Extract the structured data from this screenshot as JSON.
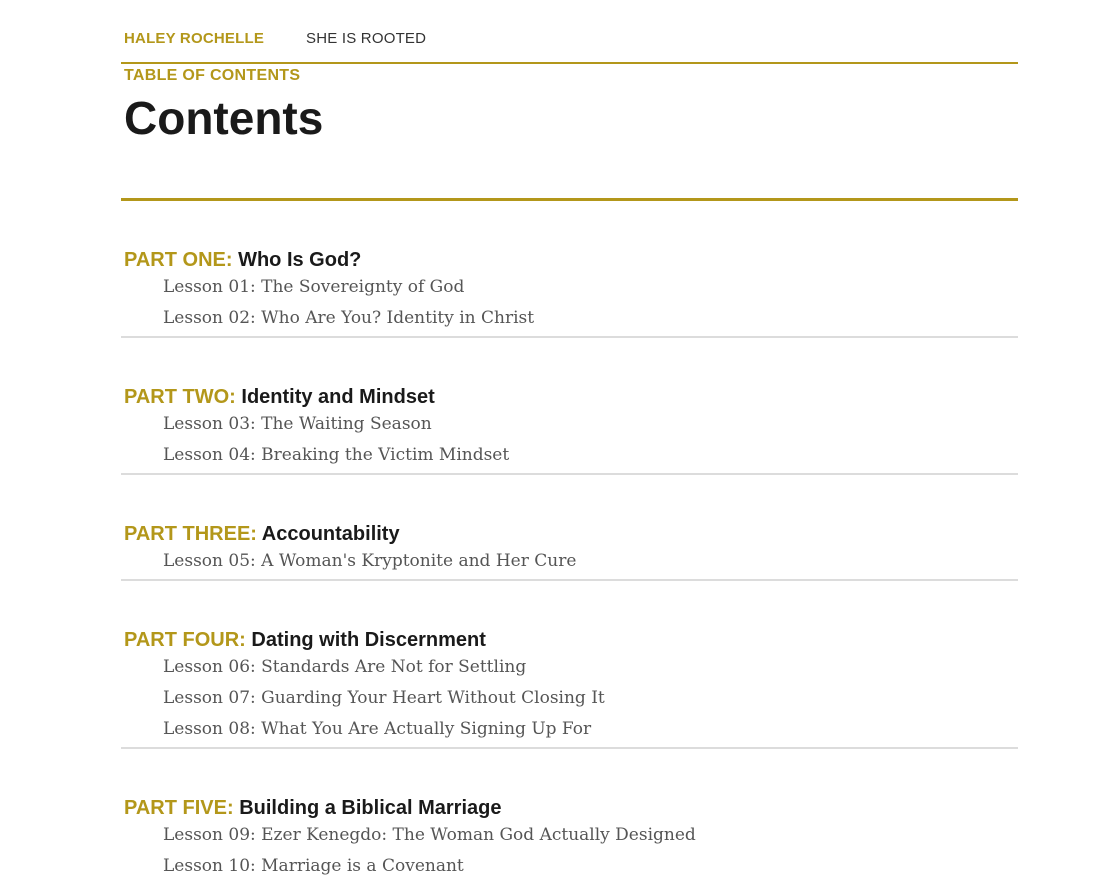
{
  "nav": {
    "brand": "HALEY ROCHELLE",
    "link": "SHE IS ROOTED"
  },
  "header": {
    "eyebrow": "TABLE OF CONTENTS",
    "title": "Contents"
  },
  "parts": [
    {
      "label": "PART ONE:",
      "name": "Who Is God?",
      "lessons": [
        "Lesson 01: The Sovereignty of God",
        "Lesson 02: Who Are You? Identity in Christ"
      ]
    },
    {
      "label": "PART TWO:",
      "name": "Identity and Mindset",
      "lessons": [
        "Lesson 03: The Waiting Season",
        "Lesson 04: Breaking the Victim Mindset"
      ]
    },
    {
      "label": "PART THREE:",
      "name": "Accountability",
      "lessons": [
        "Lesson 05: A Woman's Kryptonite and Her Cure"
      ]
    },
    {
      "label": "PART FOUR:",
      "name": "Dating with Discernment",
      "lessons": [
        "Lesson 06: Standards Are Not for Settling",
        "Lesson 07: Guarding Your Heart Without Closing It",
        "Lesson 08: What You Are Actually Signing Up For"
      ]
    },
    {
      "label": "PART FIVE:",
      "name": "Building a Biblical Marriage",
      "lessons": [
        "Lesson 09: Ezer Kenegdo: The Woman God Actually Designed",
        "Lesson 10: Marriage is a Covenant"
      ]
    }
  ],
  "colors": {
    "accent": "#b3971a",
    "heading": "#1a1a1a",
    "lesson_text": "#555555",
    "divider": "#dcdcdc"
  }
}
